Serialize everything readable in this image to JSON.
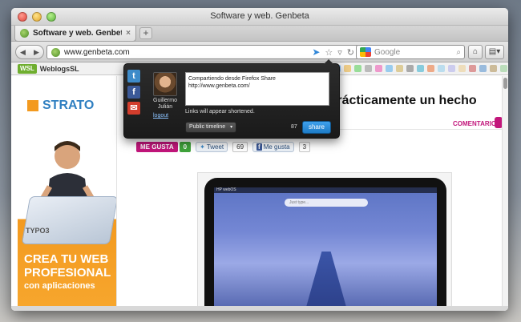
{
  "window": {
    "title": "Software y web. Genbeta"
  },
  "tab": {
    "label": "Software y web. Genbeta",
    "close": "×",
    "new_tab": "+"
  },
  "nav": {
    "back": "◀",
    "forward": "▶",
    "url": "www.genbeta.com",
    "search_placeholder": "Google",
    "home": "⌂",
    "menu": "▤▾"
  },
  "bookmarks": {
    "logo": "WSL",
    "label": "WeblogsSL"
  },
  "ad": {
    "brand": "STRATO",
    "typo3": "TYPO3",
    "line1": "CREA TU WEB",
    "line2": "PROFESIONAL",
    "line3": "con aplicaciones"
  },
  "article": {
    "title": "...WebOS es prácticamente un hecho",
    "comments": "COMENTARIOS",
    "me_gusta": "ME GUSTA",
    "me_gusta_count": "0",
    "tweet": "Tweet",
    "tweet_count": "69",
    "fb_like": "Me gusta",
    "fb_count": "3",
    "tablet_status": "HP webOS",
    "tablet_search": "Just type..."
  },
  "share_popup": {
    "user_name": "Guillermo Julián",
    "logout": "logout",
    "message": "Compartiendo desde Firefox Share\nhttp://www.genbeta.com/",
    "note": "Links will appear shortened.",
    "timeline": "Public timeline",
    "char_count": "87",
    "share_button": "share"
  }
}
